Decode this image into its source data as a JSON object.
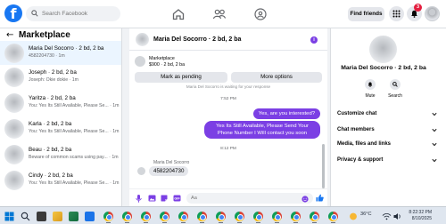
{
  "topbar": {
    "logo": "f",
    "search_placeholder": "Search Facebook",
    "find_friends_label": "Find friends",
    "notifications_count": "3"
  },
  "sidebar": {
    "back_glyph": "←",
    "title": "Marketplace",
    "conversations": [
      {
        "name": "Maria Del Socorro · 2 bd, 2 ba",
        "sub": "4582204730 · 1m"
      },
      {
        "name": "Joseph · 2 bd, 2 ba",
        "sub": "Joseph: Okie dokie · 1m"
      },
      {
        "name": "Yaritza · 2 bd, 2 ba",
        "sub": "You: Yes Its Still Available, Please Se... · 1m"
      },
      {
        "name": "Karla · 2 bd, 2 ba",
        "sub": "You: Yes Its Still Available, Please Se... · 1m"
      },
      {
        "name": "Beau · 2 bd, 2 ba",
        "sub": "Beware of common scams using pay... · 1m"
      },
      {
        "name": "Cindy · 2 bd, 2 ba",
        "sub": "You: Yes Its Still Available, Please Se... · 1m"
      }
    ]
  },
  "chat": {
    "title": "Maria Del Socorro · 2 bd, 2 ba",
    "info_glyph": "i",
    "listing_label": "Marketplace",
    "listing_sub": "$900 · 2 bd, 2 ba",
    "mark_pending_label": "Mark as pending",
    "more_options_label": "More options",
    "status_text": "Maria Del Socorro is waiting for your response",
    "time1": "7:52 PM",
    "out_msg1": "Yes, are you interested?",
    "out_msg2": "Yes Its Still Available, Please Send Your Phone Number I Will contact you soon",
    "time2": "8:12 PM",
    "in_sender": "Maria Del Socorro",
    "in_msg": "4582204730",
    "composer_placeholder": "Aa"
  },
  "rpanel": {
    "name": "Maria Del Socorro · 2 bd, 2 ba",
    "mute_label": "Mute",
    "search_label": "Search",
    "items": [
      "Customize chat",
      "Chat members",
      "Media, files and links",
      "Privacy & support"
    ]
  },
  "taskbar": {
    "temperature": "36°C",
    "time": "8:22:32 PM",
    "date": "8/10/2025"
  },
  "colors": {
    "accent": "#7b3fe4",
    "brand": "#1877f2"
  }
}
